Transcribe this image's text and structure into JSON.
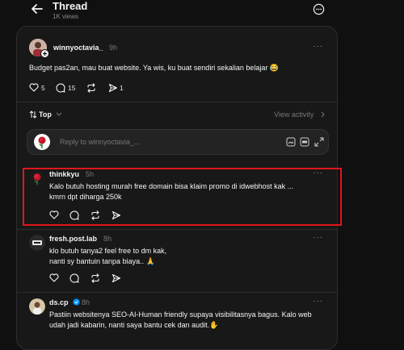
{
  "header": {
    "title": "Thread",
    "views": "1K views"
  },
  "post": {
    "username": "winnyoctavia_",
    "time": "9h",
    "text": "Budget pas2an, mau buat website. Ya wis, ku buat sendiri sekalian belajar 😂",
    "likes": "5",
    "comments": "15",
    "shares": "1"
  },
  "sort": {
    "label": "Top",
    "view_activity": "View activity"
  },
  "reply": {
    "placeholder": "Reply to winnyoctavia_..."
  },
  "replies": [
    {
      "username": "thinkkyu",
      "time": "5h",
      "lines": [
        "Kalo butuh hosting murah free domain bisa klaim promo di idwebhost kak ...",
        "kmrn dpt diharga 250k"
      ]
    },
    {
      "username": "fresh.post.lab",
      "time": "8h",
      "lines": [
        "klo butuh tanya2 feel free to dm kak,",
        "nanti sy bantuin tanpa biaya.. 🙏"
      ]
    },
    {
      "username": "ds.cp",
      "time": "8h",
      "lines": [
        "Pastiin websitenya SEO-AI-Human friendly supaya visibilitasnya bagus. Kalo web",
        "udah jadi kabarin, nanti saya bantu cek dan audit.✋"
      ]
    }
  ],
  "colors": {
    "background": "#101010",
    "panel": "#181818",
    "highlight": "#e0161b",
    "verified": "#0095f6"
  }
}
